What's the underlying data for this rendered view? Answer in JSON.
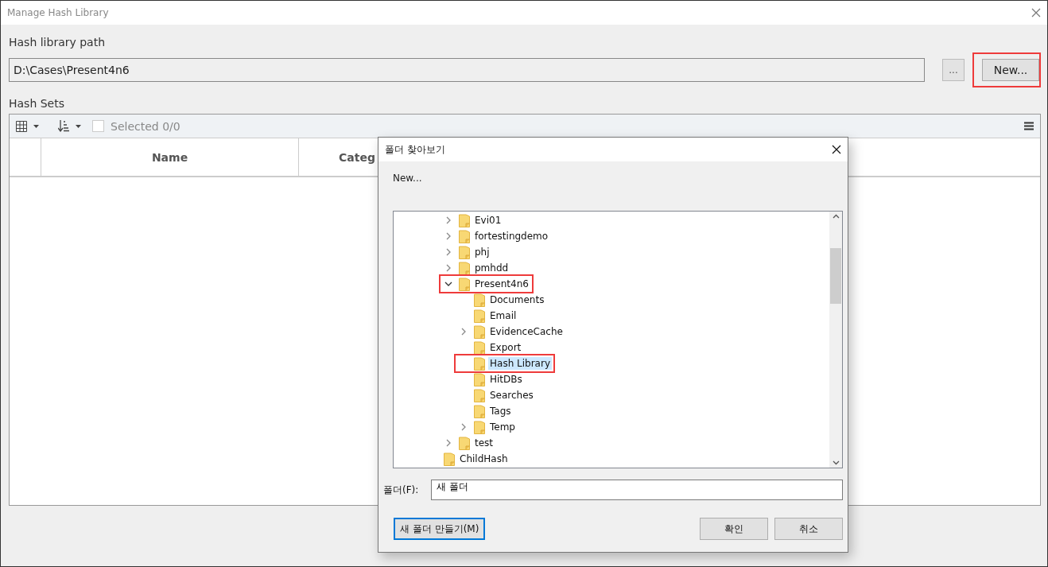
{
  "window": {
    "title": "Manage Hash Library"
  },
  "path": {
    "label": "Hash library path",
    "value": "D:\\Cases\\Present4n6",
    "browse_button": "...",
    "new_button": {
      "label": "New...",
      "highlighted": true
    }
  },
  "hash_sets": {
    "label": "Hash Sets",
    "toolbar": {
      "selected_checked": false,
      "selected_text": "Selected 0/0"
    },
    "columns": [
      "Name",
      "Categ"
    ]
  },
  "dialog": {
    "title": "폴더 찾아보기",
    "description": "New...",
    "tree": [
      {
        "label": "Evi01",
        "expandable": true,
        "expanded": false,
        "selected": false,
        "highlighted": false
      },
      {
        "label": "fortestingdemo",
        "expandable": true,
        "expanded": false,
        "selected": false,
        "highlighted": false
      },
      {
        "label": "phj",
        "expandable": true,
        "expanded": false,
        "selected": false,
        "highlighted": false
      },
      {
        "label": "pmhdd",
        "expandable": true,
        "expanded": false,
        "selected": false,
        "highlighted": false
      },
      {
        "label": "Present4n6",
        "expandable": true,
        "expanded": true,
        "selected": false,
        "highlighted": true,
        "children": [
          {
            "label": "Documents",
            "expandable": false,
            "expanded": false,
            "selected": false,
            "highlighted": false
          },
          {
            "label": "Email",
            "expandable": false,
            "expanded": false,
            "selected": false,
            "highlighted": false
          },
          {
            "label": "EvidenceCache",
            "expandable": true,
            "expanded": false,
            "selected": false,
            "highlighted": false
          },
          {
            "label": "Export",
            "expandable": false,
            "expanded": false,
            "selected": false,
            "highlighted": false
          },
          {
            "label": "Hash Library",
            "expandable": false,
            "expanded": false,
            "selected": true,
            "highlighted": true
          },
          {
            "label": "HitDBs",
            "expandable": false,
            "expanded": false,
            "selected": false,
            "highlighted": false
          },
          {
            "label": "Searches",
            "expandable": false,
            "expanded": false,
            "selected": false,
            "highlighted": false
          },
          {
            "label": "Tags",
            "expandable": false,
            "expanded": false,
            "selected": false,
            "highlighted": false
          },
          {
            "label": "Temp",
            "expandable": true,
            "expanded": false,
            "selected": false,
            "highlighted": false
          }
        ]
      },
      {
        "label": "test",
        "expandable": true,
        "expanded": false,
        "selected": false,
        "highlighted": false
      }
    ],
    "tree_outer": [
      {
        "label": "ChildHash",
        "expandable": false,
        "expanded": false,
        "selected": false,
        "highlighted": false
      }
    ],
    "folder_label": "폴더(F):",
    "folder_value": "새 폴더",
    "make_folder_button": "새 폴더 만들기(M)",
    "ok_button": "확인",
    "cancel_button": "취소"
  }
}
